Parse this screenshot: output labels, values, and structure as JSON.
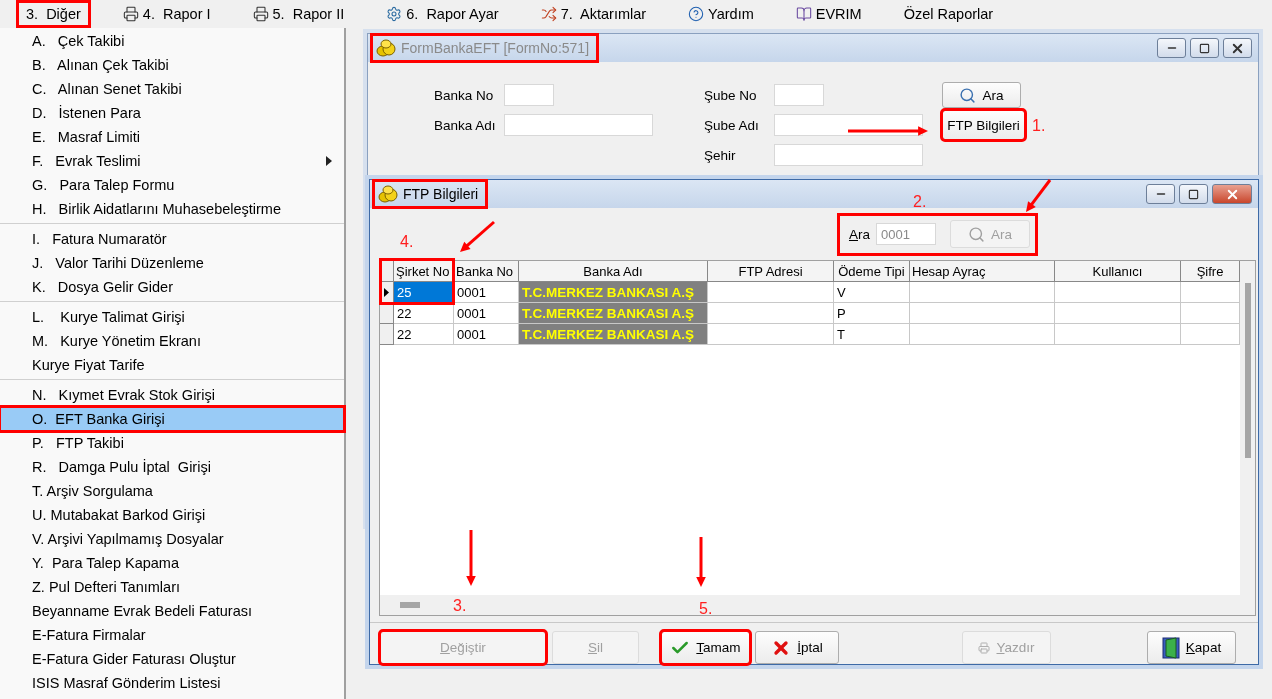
{
  "menu_bar": {
    "items": [
      {
        "label": "3.  Diğer",
        "highlighted": true
      },
      {
        "label": "4.  Rapor I",
        "highlighted": false
      },
      {
        "label": "5.  Rapor II",
        "highlighted": false
      },
      {
        "label": "6.  Rapor Ayar",
        "highlighted": false
      },
      {
        "label": "7.  Aktarımlar",
        "highlighted": false
      },
      {
        "label": "Yardım",
        "highlighted": false
      },
      {
        "label": "EVRIM",
        "highlighted": false
      },
      {
        "label": "Özel Raporlar",
        "highlighted": false
      }
    ]
  },
  "dropdown": {
    "items": [
      {
        "kind": "item",
        "label": "A.   Çek Takibi",
        "selected": false,
        "highlighted": false,
        "has_submenu": false
      },
      {
        "kind": "item",
        "label": "B.   Alınan Çek Takibi",
        "selected": false,
        "highlighted": false,
        "has_submenu": false
      },
      {
        "kind": "item",
        "label": "C.   Alınan Senet Takibi",
        "selected": false,
        "highlighted": false,
        "has_submenu": false
      },
      {
        "kind": "item",
        "label": "D.   İstenen Para",
        "selected": false,
        "highlighted": false,
        "has_submenu": false
      },
      {
        "kind": "item",
        "label": "E.   Masraf Limiti",
        "selected": false,
        "highlighted": false,
        "has_submenu": false
      },
      {
        "kind": "item",
        "label": "F.   Evrak Teslimi",
        "selected": false,
        "highlighted": false,
        "has_submenu": true
      },
      {
        "kind": "item",
        "label": "G.   Para Talep Formu",
        "selected": false,
        "highlighted": false,
        "has_submenu": false
      },
      {
        "kind": "item",
        "label": "H.   Birlik Aidatlarını Muhasebeleştirme",
        "selected": false,
        "highlighted": false,
        "has_submenu": false
      },
      {
        "kind": "separator"
      },
      {
        "kind": "item",
        "label": "I.   Fatura Numaratör",
        "selected": false,
        "highlighted": false,
        "has_submenu": false
      },
      {
        "kind": "item",
        "label": "J.   Valor Tarihi Düzenleme",
        "selected": false,
        "highlighted": false,
        "has_submenu": false
      },
      {
        "kind": "item",
        "label": "K.   Dosya Gelir Gider",
        "selected": false,
        "highlighted": false,
        "has_submenu": false
      },
      {
        "kind": "separator"
      },
      {
        "kind": "item",
        "label": "L.    Kurye Talimat Girişi",
        "selected": false,
        "highlighted": false,
        "has_submenu": false
      },
      {
        "kind": "item",
        "label": "M.   Kurye Yönetim Ekranı",
        "selected": false,
        "highlighted": false,
        "has_submenu": false
      },
      {
        "kind": "item",
        "label": "Kurye Fiyat Tarife",
        "selected": false,
        "highlighted": false,
        "has_submenu": false
      },
      {
        "kind": "separator"
      },
      {
        "kind": "item",
        "label": "N.   Kıymet Evrak Stok Girişi",
        "selected": false,
        "highlighted": false,
        "has_submenu": false
      },
      {
        "kind": "item",
        "label": "O.  EFT Banka Girişi",
        "selected": true,
        "highlighted": true,
        "has_submenu": false
      },
      {
        "kind": "item",
        "label": "P.   FTP Takibi",
        "selected": false,
        "highlighted": false,
        "has_submenu": false
      },
      {
        "kind": "item",
        "label": "R.   Damga Pulu İptal  Girişi",
        "selected": false,
        "highlighted": false,
        "has_submenu": false
      },
      {
        "kind": "item",
        "label": "T. Arşiv Sorgulama",
        "selected": false,
        "highlighted": false,
        "has_submenu": false
      },
      {
        "kind": "item",
        "label": "U. Mutabakat Barkod Girişi",
        "selected": false,
        "highlighted": false,
        "has_submenu": false
      },
      {
        "kind": "item",
        "label": "V. Arşivi Yapılmamış Dosyalar",
        "selected": false,
        "highlighted": false,
        "has_submenu": false
      },
      {
        "kind": "item",
        "label": "Y.  Para Talep Kapama",
        "selected": false,
        "highlighted": false,
        "has_submenu": false
      },
      {
        "kind": "item",
        "label": "Z. Pul Defteri Tanımları",
        "selected": false,
        "highlighted": false,
        "has_submenu": false
      },
      {
        "kind": "item",
        "label": "Beyanname Evrak Bedeli Faturası",
        "selected": false,
        "highlighted": false,
        "has_submenu": false
      },
      {
        "kind": "item",
        "label": "E-Fatura Firmalar",
        "selected": false,
        "highlighted": false,
        "has_submenu": false
      },
      {
        "kind": "item",
        "label": "E-Fatura Gider Faturası Oluştur",
        "selected": false,
        "highlighted": false,
        "has_submenu": false
      },
      {
        "kind": "item",
        "label": "ISIS Masraf Gönderim Listesi",
        "selected": false,
        "highlighted": false,
        "has_submenu": false
      }
    ]
  },
  "form_window": {
    "title": "FormBankaEFT [FormNo:571]",
    "highlighted": true,
    "fields": [
      {
        "label": "Banka No"
      },
      {
        "label": "Banka Adı"
      },
      {
        "label": "Şube No"
      },
      {
        "label": "Şube Adı"
      },
      {
        "label": "Şehir"
      }
    ],
    "buttons": [
      {
        "label": "Ara",
        "highlighted": false
      },
      {
        "label": "FTP Bilgileri",
        "highlighted": true
      }
    ]
  },
  "ftp_window": {
    "title": "FTP Bilgileri",
    "highlighted": true,
    "search": {
      "label": "Ara",
      "value": "0001",
      "highlighted": true,
      "button": {
        "label": "Ara",
        "disabled": true
      }
    },
    "table": {
      "first_column_highlighted": true,
      "columns": [
        "Şirket No",
        "Banka No",
        "Banka Adı",
        "FTP Adresi",
        "Ödeme Tipi",
        "Hesap Ayraç",
        "Kullanıcı",
        "Şifre"
      ],
      "rows": [
        {
          "selected": true,
          "cells": [
            "25",
            "0001",
            "T.C.MERKEZ BANKASI A.Ş",
            "",
            "V",
            "",
            "",
            ""
          ]
        },
        {
          "selected": false,
          "cells": [
            "22",
            "0001",
            "T.C.MERKEZ BANKASI A.Ş",
            "",
            "P",
            "",
            "",
            ""
          ]
        },
        {
          "selected": false,
          "cells": [
            "22",
            "0001",
            "T.C.MERKEZ BANKASI A.Ş",
            "",
            "T",
            "",
            "",
            ""
          ]
        }
      ]
    },
    "buttons": [
      {
        "label": "Değiştir",
        "disabled": true,
        "highlighted": true
      },
      {
        "label": "Sil",
        "disabled": true,
        "highlighted": false
      },
      {
        "label": "Tamam",
        "disabled": false,
        "highlighted": true
      },
      {
        "label": "İptal",
        "disabled": false,
        "highlighted": false
      },
      {
        "label": "Yazdır",
        "disabled": true,
        "highlighted": false
      },
      {
        "label": "Kapat",
        "disabled": false,
        "highlighted": false
      }
    ]
  },
  "annotations": [
    {
      "label": "1."
    },
    {
      "label": "2."
    },
    {
      "label": "3."
    },
    {
      "label": "4."
    },
    {
      "label": "5."
    }
  ]
}
